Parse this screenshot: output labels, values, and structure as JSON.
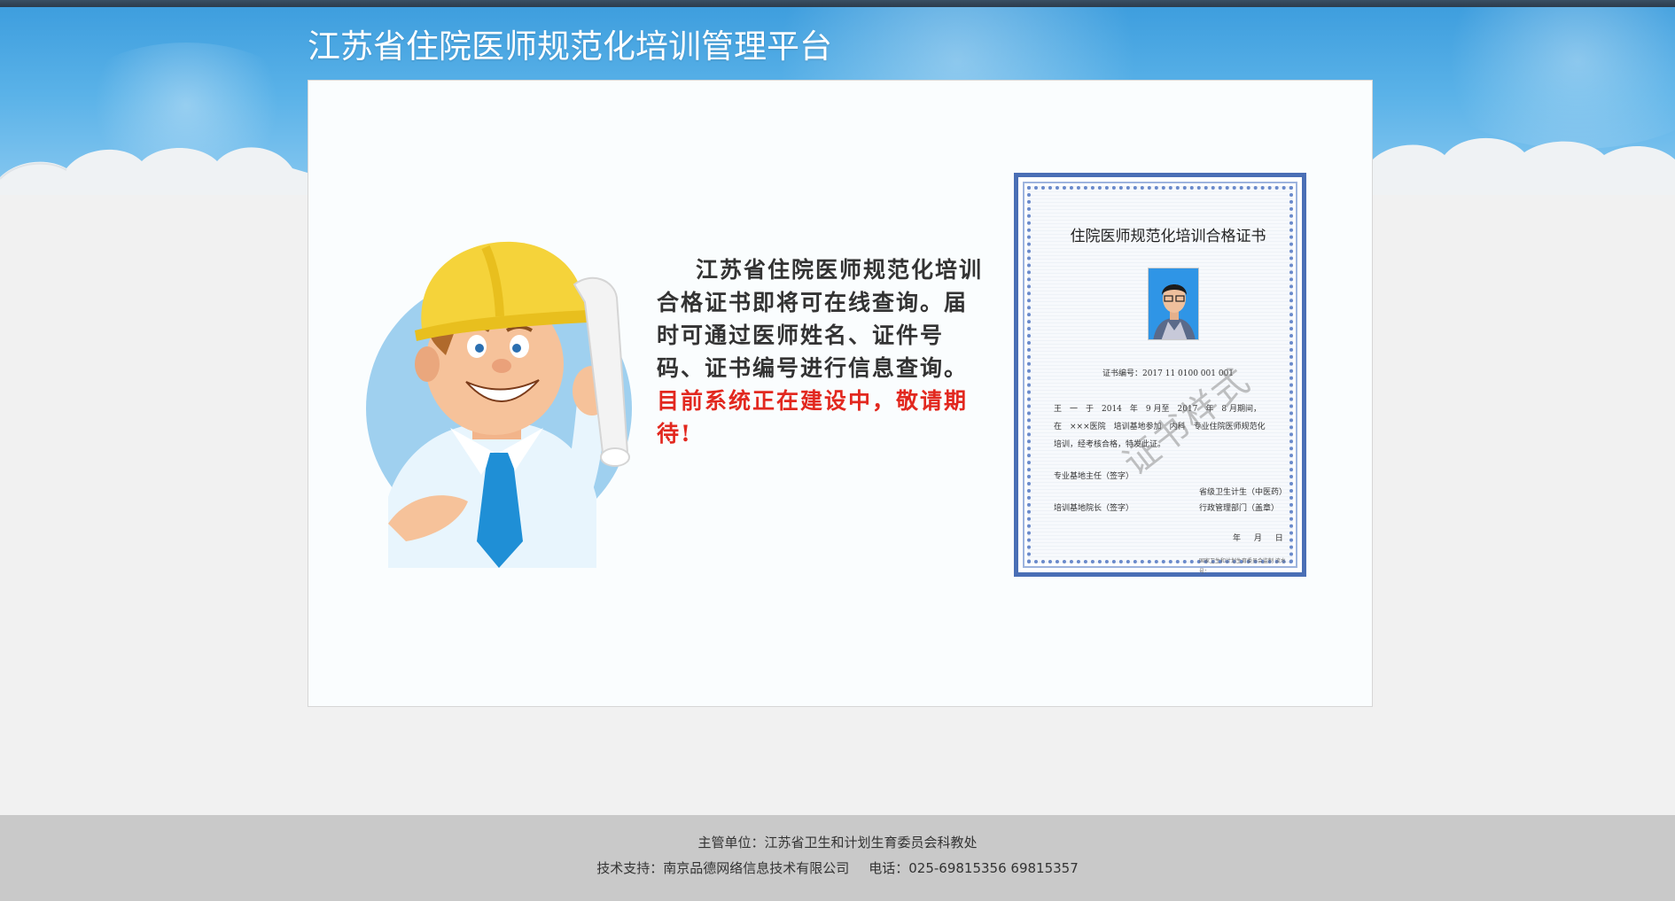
{
  "header": {
    "title": "江苏省住院医师规范化培训管理平台"
  },
  "notice": {
    "text_main": "江苏省住院医师规范化培训合格证书即将可在线查询。届时可通过医师姓名、证件号码、证书编号进行信息查询。",
    "text_highlight": "目前系统正在建设中，敬请期待!",
    "highlight_color": "#e2281f"
  },
  "certificate": {
    "title": "住院医师规范化培训合格证书",
    "number": "证书编号：2017 11 0100 001 001",
    "body_line1": "王　一　于　2014　年　9 月至　2017　年　8 月期间，",
    "body_line2": "在　×××医院　培训基地参加　内科　专业住院医师规范化",
    "body_line3": "培训，经考核合格，特发此证。",
    "sign_left1": "专业基地主任（签字）",
    "sign_right1": "省级卫生计生（中医药）",
    "sign_left2": "培训基地院长（签字）",
    "sign_right2": "行政管理部门（盖章）",
    "date": "年 月 日",
    "footnote": "国家卫生和计划生育委员会监制 流水号：",
    "watermark": "证书样式"
  },
  "footer": {
    "sponsor": "主管单位：江苏省卫生和计划生育委员会科教处",
    "support": "技术支持：南京品德网络信息技术有限公司",
    "phone": "电话：025-69815356 69815357"
  },
  "colors": {
    "sky_blue": "#4aa8e4",
    "background": "#f1f1f1",
    "footer_bg": "#c9c9c9",
    "cert_border": "#4a6fb5"
  }
}
